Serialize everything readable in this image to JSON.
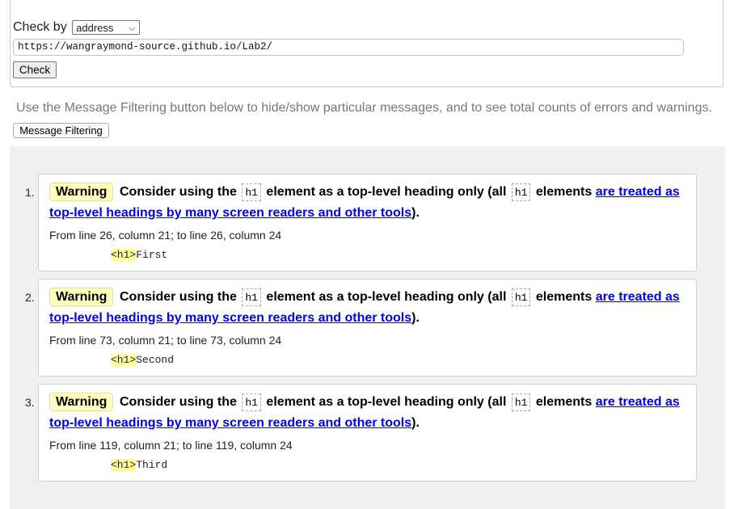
{
  "form": {
    "check_by_label": "Check by",
    "select_value": "address",
    "url_value": "https://wangraymond-source.github.io/Lab2/",
    "check_button": "Check"
  },
  "info_text": "Use the Message Filtering button below to hide/show particular messages, and to see total counts of errors and warnings.",
  "filter_button": "Message Filtering",
  "messages": [
    {
      "num": "1.",
      "badge": "Warning",
      "text_a": "Consider using the",
      "code_a": "h1",
      "text_b": "element as a top-level heading only (all",
      "code_b": "h1",
      "text_c": "elements",
      "link_a": "are treated as",
      "link_b": "top-level headings by many screen readers and other tools",
      "text_end": ").",
      "location": "From line 26, column 21; to line 26, column 24",
      "tag": "<h1>",
      "content": "First"
    },
    {
      "num": "2.",
      "badge": "Warning",
      "text_a": "Consider using the",
      "code_a": "h1",
      "text_b": "element as a top-level heading only (all",
      "code_b": "h1",
      "text_c": "elements",
      "link_a": "are treated as",
      "link_b": "top-level headings by many screen readers and other tools",
      "text_end": ").",
      "location": "From line 73, column 21; to line 73, column 24",
      "tag": "<h1>",
      "content": "Second"
    },
    {
      "num": "3.",
      "badge": "Warning",
      "text_a": "Consider using the",
      "code_a": "h1",
      "text_b": "element as a top-level heading only (all",
      "code_b": "h1",
      "text_c": "elements",
      "link_a": "are treated as",
      "link_b": "top-level headings by many screen readers and other tools",
      "text_end": ").",
      "location": "From line 119, column 21; to line 119, column 24",
      "tag": "<h1>",
      "content": "Third"
    }
  ],
  "colors": {
    "link": "#0000ee",
    "warning_badge_bg": "#ffffc0",
    "tag_highlight": "#ffff99",
    "results_bg": "#f0f0f0"
  }
}
